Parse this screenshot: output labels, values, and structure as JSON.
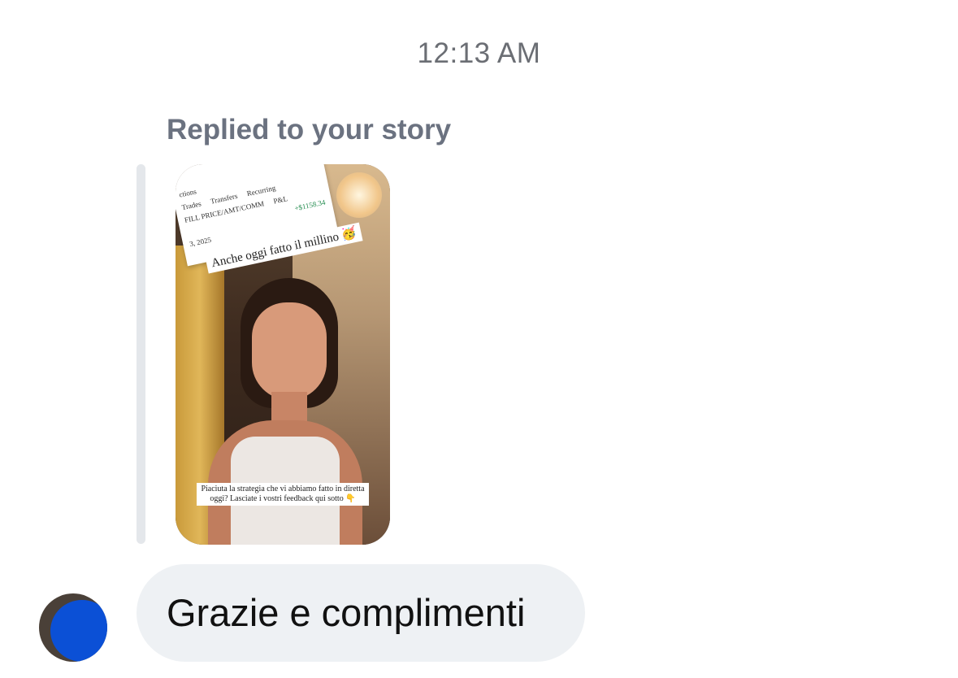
{
  "timestamp": "12:13 AM",
  "reply": {
    "label": "Replied to your story"
  },
  "story": {
    "overlay_top": "Anche oggi fatto il millino 🥳",
    "overlay_bottom": "Piaciuta la strategia che vi abbiamo fatto in diretta oggi? Lasciate i vostri feedback qui sotto 👇",
    "screenshot": {
      "title_fragment": "ctions",
      "tabs": [
        "Trades",
        "Transfers",
        "Recurring"
      ],
      "date_fragment": "3, 2025",
      "fill_label": "FILL PRICE/AMT/COMM",
      "pnl_label": "P&L",
      "pnl_value": "+$1158.34"
    }
  },
  "message": {
    "text": "Grazie e complimenti"
  },
  "colors": {
    "bubble": "#eef1f4",
    "avatar_overlay": "#0b50d6",
    "muted_text": "#6b7280"
  }
}
